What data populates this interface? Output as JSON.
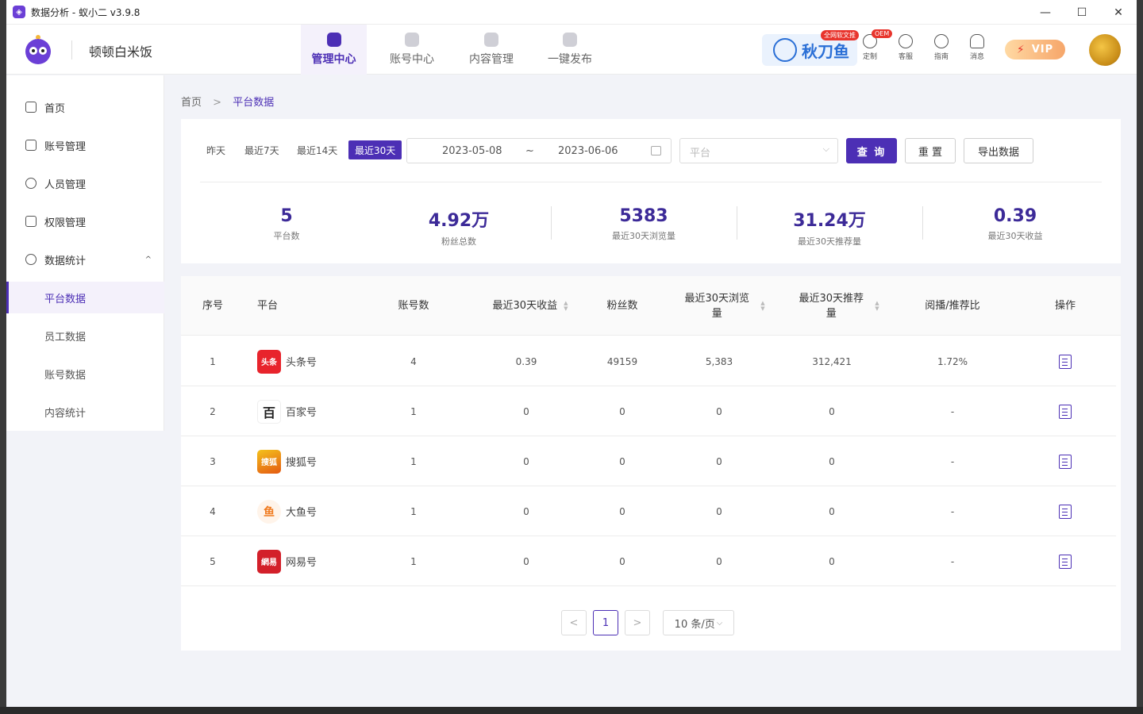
{
  "window": {
    "title": "数据分析 - 蚁小二 v3.9.8",
    "minimize": "—",
    "maximize": "☐",
    "close": "✕"
  },
  "header": {
    "user_name": "顿顿白米饭",
    "tabs": [
      "管理中心",
      "账号中心",
      "内容管理",
      "一键发布"
    ],
    "banner_text": "秋刀鱼",
    "banner_tag": "全网软文推",
    "oem_badge": "OEM",
    "tools": [
      "定制",
      "客服",
      "指南",
      "消息"
    ],
    "vip_label": "VIP"
  },
  "sidebar": {
    "items": [
      {
        "label": "首页",
        "icon": "home-icon"
      },
      {
        "label": "账号管理",
        "icon": "grid-icon"
      },
      {
        "label": "人员管理",
        "icon": "user-icon"
      },
      {
        "label": "权限管理",
        "icon": "lock-icon"
      },
      {
        "label": "数据统计",
        "icon": "chart-icon"
      }
    ],
    "sub_items": [
      "平台数据",
      "员工数据",
      "账号数据",
      "内容统计"
    ],
    "expand_indicator": "^"
  },
  "breadcrumb": {
    "home": "首页",
    "separator": ">",
    "current": "平台数据"
  },
  "filters": {
    "quick_ranges": [
      "昨天",
      "最近7天",
      "最近14天",
      "最近30天"
    ],
    "active_range": "最近30天",
    "start_date": "2023-05-08",
    "range_sep": "~",
    "end_date": "2023-06-06",
    "platform_placeholder": "平台",
    "query_button": "查 询",
    "reset_button": "重 置",
    "export_button": "导出数据"
  },
  "stats": [
    {
      "value": "5",
      "label": "平台数"
    },
    {
      "value": "4.92万",
      "label": "粉丝总数"
    },
    {
      "value": "5383",
      "label": "最近30天浏览量"
    },
    {
      "value": "31.24万",
      "label": "最近30天推荐量"
    },
    {
      "value": "0.39",
      "label": "最近30天收益"
    }
  ],
  "table": {
    "headers": {
      "index": "序号",
      "platform": "平台",
      "accounts": "账号数",
      "revenue": "最近30天收益",
      "fans": "粉丝数",
      "views": "最近30天浏览量",
      "recommend": "最近30天推荐量",
      "ratio": "阅播/推荐比",
      "action": "操作"
    },
    "sort_glyphs": {
      "up": "▲",
      "down": "▼"
    },
    "rows": [
      {
        "index": "1",
        "platform": "头条号",
        "logo_text": "头条",
        "logo_color": "#e8242c",
        "accounts": "4",
        "revenue": "0.39",
        "fans": "49159",
        "views": "5,383",
        "recommend": "312,421",
        "ratio": "1.72%"
      },
      {
        "index": "2",
        "platform": "百家号",
        "logo_text": "百",
        "logo_color": "#1f1f1f",
        "accounts": "1",
        "revenue": "0",
        "fans": "0",
        "views": "0",
        "recommend": "0",
        "ratio": "-"
      },
      {
        "index": "3",
        "platform": "搜狐号",
        "logo_text": "搜狐",
        "logo_color": "#e98b14",
        "accounts": "1",
        "revenue": "0",
        "fans": "0",
        "views": "0",
        "recommend": "0",
        "ratio": "-"
      },
      {
        "index": "4",
        "platform": "大鱼号",
        "logo_text": "鱼",
        "logo_color": "#f07a1e",
        "accounts": "1",
        "revenue": "0",
        "fans": "0",
        "views": "0",
        "recommend": "0",
        "ratio": "-"
      },
      {
        "index": "5",
        "platform": "网易号",
        "logo_text": "網易",
        "logo_color": "#d3202a",
        "accounts": "1",
        "revenue": "0",
        "fans": "0",
        "views": "0",
        "recommend": "0",
        "ratio": "-"
      }
    ]
  },
  "pagination": {
    "prev": "<",
    "page": "1",
    "next": ">",
    "page_size": "10 条/页"
  },
  "colors": {
    "accent": "#4c2fb5",
    "stat_value": "#3c2a98",
    "background": "#f2f3f8"
  }
}
